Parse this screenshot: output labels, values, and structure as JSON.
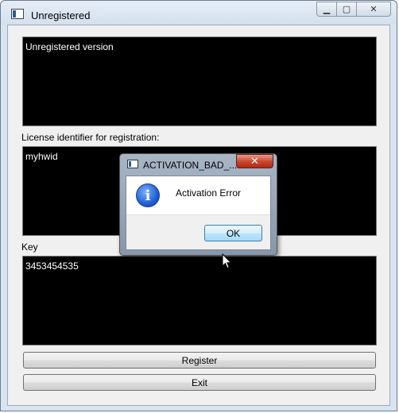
{
  "window": {
    "title": "Unregistered",
    "minimize_glyph": "▁",
    "maximize_glyph": "▢",
    "close_glyph": "✕"
  },
  "status_box": {
    "text": "Unregistered version"
  },
  "license": {
    "label": "License identifier for registration:",
    "value": "myhwid"
  },
  "key": {
    "label": "Key",
    "value": "3453454535"
  },
  "buttons": {
    "register_label": "Register",
    "exit_label": "Exit"
  },
  "dialog": {
    "title": "ACTIVATION_BAD_...",
    "close_glyph": "✕",
    "icon_glyph": "i",
    "message": "Activation Error",
    "ok_label": "OK"
  },
  "icons": [
    "app-icon",
    "minimize-icon",
    "maximize-icon",
    "close-icon",
    "info-icon",
    "mouse-cursor-icon"
  ]
}
